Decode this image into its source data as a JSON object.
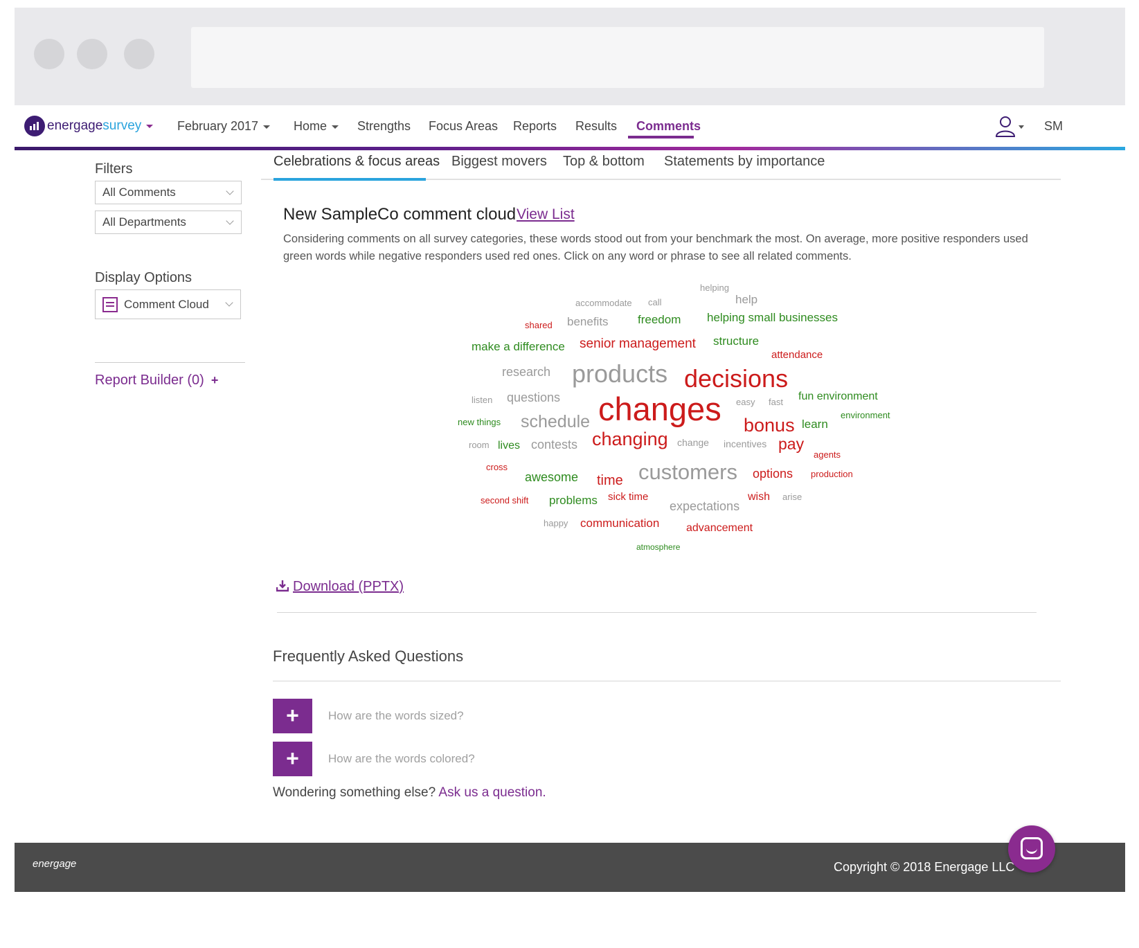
{
  "brand": {
    "name_part1": "energage",
    "name_part2": "survey"
  },
  "nav": {
    "period": "February 2017",
    "items": [
      "Home",
      "Strengths",
      "Focus Areas",
      "Reports",
      "Results",
      "Comments"
    ],
    "user_initials": "SM"
  },
  "sidebar": {
    "filters_heading": "Filters",
    "filter_comments": "All Comments",
    "filter_departments": "All Departments",
    "display_heading": "Display Options",
    "display_value": "Comment Cloud",
    "report_builder": "Report Builder (0)",
    "report_builder_plus": "+"
  },
  "tabs": [
    "Celebrations & focus areas",
    "Biggest movers",
    "Top & bottom",
    "Statements by importance"
  ],
  "cloud": {
    "title": "New SampleCo comment cloud",
    "view_list": "View List",
    "description": "Considering comments on all survey categories, these words stood out from your benchmark the most. On average, more positive responders used green words while negative responders used red ones. Click on any word or phrase to see all related comments.",
    "words": [
      "helping",
      "help",
      "accommodate",
      "call",
      "shared",
      "benefits",
      "freedom",
      "helping small businesses",
      "make a difference",
      "senior management",
      "structure",
      "attendance",
      "research",
      "products",
      "decisions",
      "listen",
      "questions",
      "changes",
      "easy",
      "fast",
      "fun environment",
      "environment",
      "new things",
      "schedule",
      "bonus",
      "learn",
      "room",
      "lives",
      "contests",
      "changing",
      "change",
      "incentives",
      "pay",
      "agents",
      "cross",
      "awesome",
      "time",
      "customers",
      "options",
      "production",
      "second shift",
      "problems",
      "sick time",
      "expectations",
      "wish",
      "arise",
      "happy",
      "communication",
      "advancement",
      "atmosphere"
    ]
  },
  "download": "Download (PPTX)",
  "faq": {
    "title": "Frequently Asked Questions",
    "q1": "How are the words sized?",
    "q2": "How are the words colored?",
    "plus": "+",
    "wonder_text": "Wondering something else? ",
    "wonder_link": "Ask us a question."
  },
  "footer": {
    "logo": "energage",
    "copyright": "Copyright © 2018 Energage LLC"
  },
  "colors": {
    "accent": "#7b2c8f",
    "positive": "#2e8b1f",
    "negative": "#cc1b1b",
    "neutral": "#9a9a9a",
    "tab_active": "#2ba4dd"
  }
}
